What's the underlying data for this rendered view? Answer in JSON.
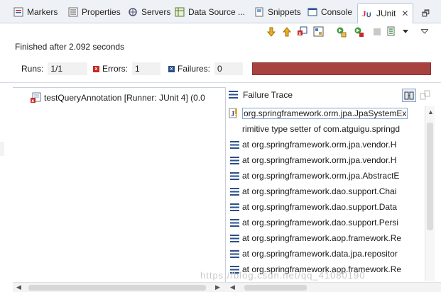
{
  "tabs": [
    {
      "label": "Markers",
      "icon": "markers-icon"
    },
    {
      "label": "Properties",
      "icon": "properties-icon"
    },
    {
      "label": "Servers",
      "icon": "servers-icon"
    },
    {
      "label": "Data Source ...",
      "icon": "data-source-icon"
    },
    {
      "label": "Snippets",
      "icon": "snippets-icon"
    },
    {
      "label": "Console",
      "icon": "console-icon"
    },
    {
      "label": "JUnit",
      "icon": "junit-icon",
      "active": true,
      "close": "✕"
    }
  ],
  "window_controls": {
    "minmax": "🗗"
  },
  "junit": {
    "finished_text": "Finished after 2.092 seconds",
    "runs_label": "Runs:",
    "runs_value": "1/1",
    "errors_label": "Errors:",
    "errors_value": "1",
    "failures_label": "Failures:",
    "failures_value": "0",
    "progress_fraction": 1.0,
    "progress_color": "#a8423f"
  },
  "tree": {
    "items": [
      {
        "label": "testQueryAnnotation [Runner: JUnit 4] (0.0",
        "status": "error"
      }
    ]
  },
  "trace": {
    "title": "Failure Trace",
    "lines": [
      "org.springframework.orm.jpa.JpaSystemEx",
      "rimitive type setter of com.atguigu.springd",
      "at org.springframework.orm.jpa.vendor.H",
      "at org.springframework.orm.jpa.vendor.H",
      "at org.springframework.orm.jpa.AbstractE",
      "at org.springframework.dao.support.Chai",
      "at org.springframework.dao.support.Data",
      "at org.springframework.dao.support.Persi",
      "at org.springframework.aop.framework.Re",
      "at org.springframework.data.jpa.repositor",
      "at org.springframework.aop.framework.Re"
    ]
  },
  "watermark": "https://blog.csdn.net/qq_41080190"
}
